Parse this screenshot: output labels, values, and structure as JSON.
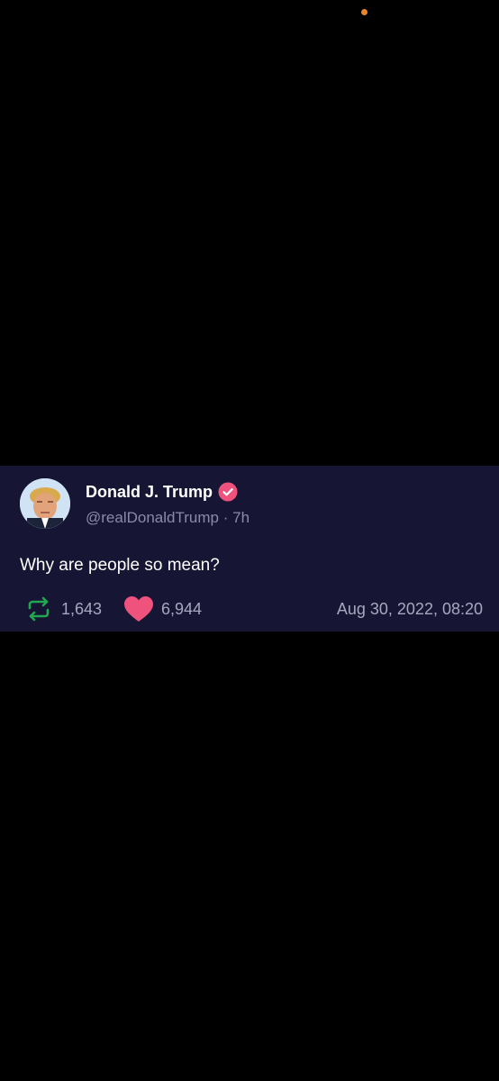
{
  "colors": {
    "page_background": "#000000",
    "card_background": "#161533",
    "status_dot": "#e8862a",
    "verified_badge": "#f0527e",
    "repost_green": "#1fa84f",
    "like_pink": "#f0527e"
  },
  "post": {
    "author_name": "Donald J. Trump",
    "handle": "@realDonaldTrump",
    "separator": "·",
    "age": "7h",
    "text": "Why are people so mean?",
    "reposts": "1,643",
    "likes": "6,944",
    "timestamp": "Aug 30, 2022, 08:20"
  },
  "icons": {
    "verified": "verified-badge-icon",
    "repost": "repost-icon",
    "like": "heart-icon"
  }
}
